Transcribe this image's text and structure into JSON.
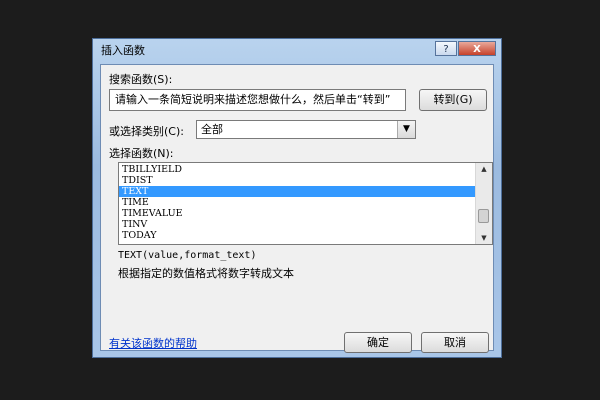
{
  "window": {
    "title": "插入函数",
    "help_button": "?",
    "close_button": "X"
  },
  "search": {
    "label": "搜索函数(S):",
    "placeholder": "请输入一条简短说明来描述您想做什么，然后单击“转到”",
    "go_button": "转到(G)"
  },
  "category": {
    "label": "或选择类别(C):",
    "selected": "全部"
  },
  "functions": {
    "label": "选择函数(N):",
    "items": [
      "TBILLYIELD",
      "TDIST",
      "TEXT",
      "TIME",
      "TIMEVALUE",
      "TINV",
      "TODAY"
    ],
    "selected_index": 2
  },
  "details": {
    "signature": "TEXT(value,format_text)",
    "description": "根据指定的数值格式将数字转成文本"
  },
  "footer": {
    "help_link": "有关该函数的帮助",
    "ok_button": "确定",
    "cancel_button": "取消"
  }
}
